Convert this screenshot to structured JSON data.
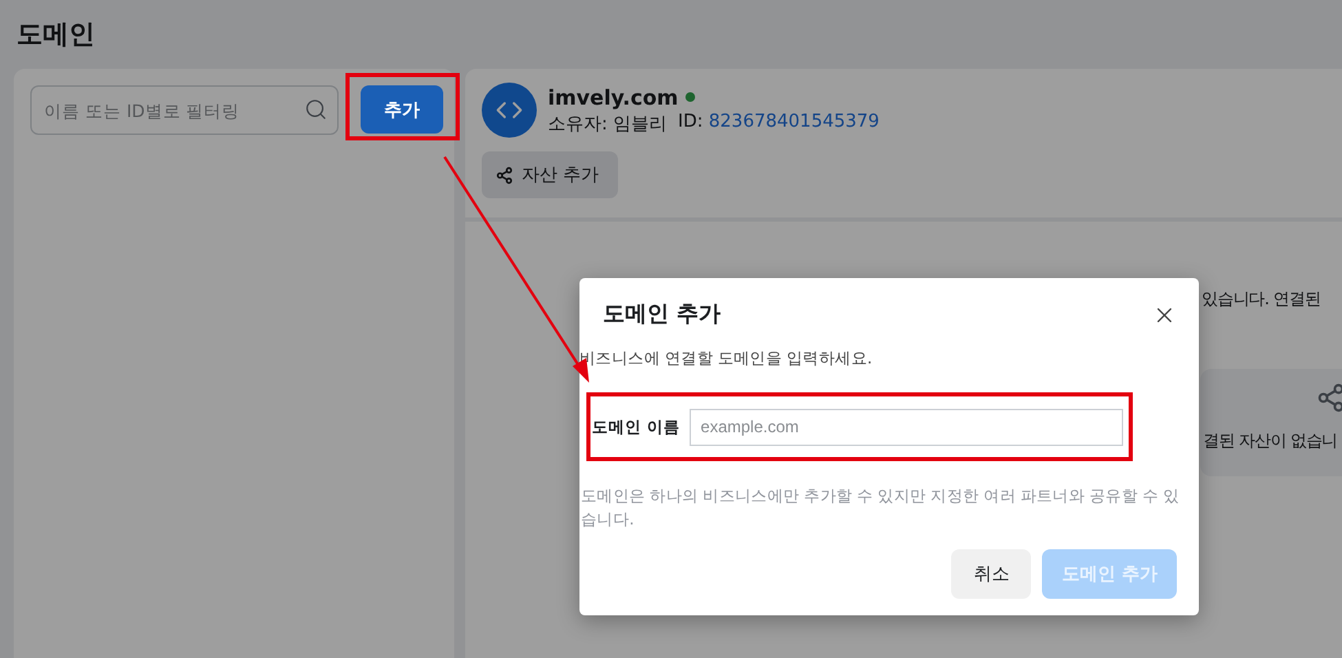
{
  "page": {
    "title": "도메인"
  },
  "sidebar": {
    "search": {
      "placeholder": "이름 또는 ID별로 필터링"
    },
    "add_button": "추가"
  },
  "domain": {
    "name": "imvely.com",
    "verified": true,
    "owner": "소유자: 임블리",
    "id_label": "ID:",
    "id": "823678401545379",
    "add_asset_button": "자산 추가"
  },
  "assets": {
    "notice": "있습니다. 연결된",
    "empty_text": "결된 자산이 없습니"
  },
  "dialog": {
    "title": "도메인 추가",
    "description": "비즈니스에 연결할 도메인을 입력하세요.",
    "field": {
      "label": "도메인 이름",
      "placeholder": "example.com"
    },
    "note": "도메인은 하나의 비즈니스에만 추가할 수 있지만 지정한 여러 파트너와 공유할 수 있습니다.",
    "buttons": [
      {
        "label": "취소",
        "kind": "secondary",
        "disabled": false
      },
      {
        "label": "도메인 추가",
        "kind": "primary",
        "disabled": true
      }
    ]
  }
}
